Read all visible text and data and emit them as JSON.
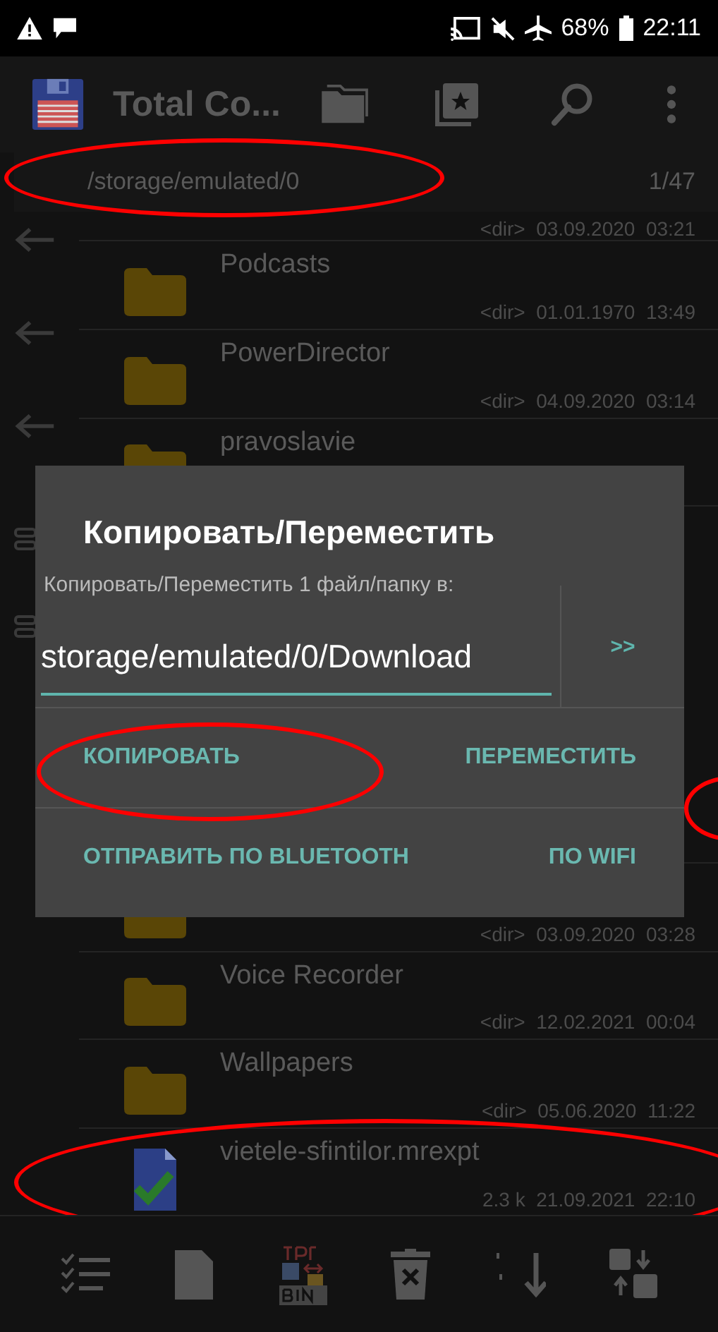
{
  "status_bar": {
    "battery": "68%",
    "time": "22:11"
  },
  "toolbar": {
    "title": "Total Co..."
  },
  "path_bar": {
    "path": "/storage/emulated/0",
    "count": "1/47",
    "circled": true
  },
  "rows_top": [
    {
      "kind": "partial",
      "meta": "<dir>  03.09.2020  03:21",
      "circled": false
    },
    {
      "kind": "folder",
      "name": "Podcasts",
      "meta": "<dir>  01.01.1970  13:49",
      "circled": false
    },
    {
      "kind": "folder",
      "name": "PowerDirector",
      "meta": "<dir>  04.09.2020  03:14",
      "circled": false
    },
    {
      "kind": "folder",
      "name": "pravoslavie",
      "circled": false
    }
  ],
  "rows_bottom": [
    {
      "kind": "folder",
      "meta": "<dir>  03.09.2020  03:28",
      "circled": false
    },
    {
      "kind": "folder",
      "name": "Voice Recorder",
      "meta": "<dir>  12.02.2021  00:04",
      "circled": false
    },
    {
      "kind": "folder",
      "name": "Wallpapers",
      "meta": "<dir>  05.06.2020  11:22",
      "circled": false
    },
    {
      "kind": "file",
      "name": "vietele-sfintilor.mrexpt",
      "meta": "2.3 k  21.09.2021  22:10",
      "circled": true
    }
  ],
  "edge_mark": true,
  "dialog": {
    "title": "Копировать/Переместить",
    "message": "Копировать/Переместить 1 файл/папку в:",
    "target": "storage/emulated/0/Download",
    "browse": ">>",
    "buttons": [
      {
        "label": "КОПИРОВАТЬ",
        "circled": true
      },
      {
        "label": "ПЕРЕМЕСТИТЬ",
        "circled": false
      },
      {
        "label": "ОТПРАВИТЬ ПО BLUETOOTH",
        "circled": false
      },
      {
        "label": "ПО WIFI",
        "circled": false
      }
    ]
  }
}
